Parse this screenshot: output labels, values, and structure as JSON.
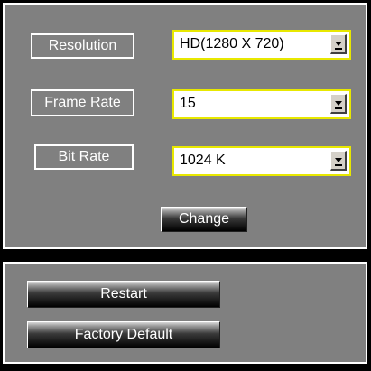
{
  "video_settings": {
    "resolution": {
      "label": "Resolution",
      "selected": "HD(1280 X 720)"
    },
    "frame_rate": {
      "label": "Frame Rate",
      "selected": "15"
    },
    "bit_rate": {
      "label": "Bit Rate",
      "selected": "1024 K"
    },
    "change_button_label": "Change"
  },
  "system_actions": {
    "restart_label": "Restart",
    "factory_default_label": "Factory Default"
  },
  "colors": {
    "panel_background": "#808080",
    "page_background": "#000000",
    "select_border": "#e8e800",
    "label_border": "#ffffff"
  },
  "icons": {
    "dropdown_arrow": "chevron-down-icon"
  }
}
